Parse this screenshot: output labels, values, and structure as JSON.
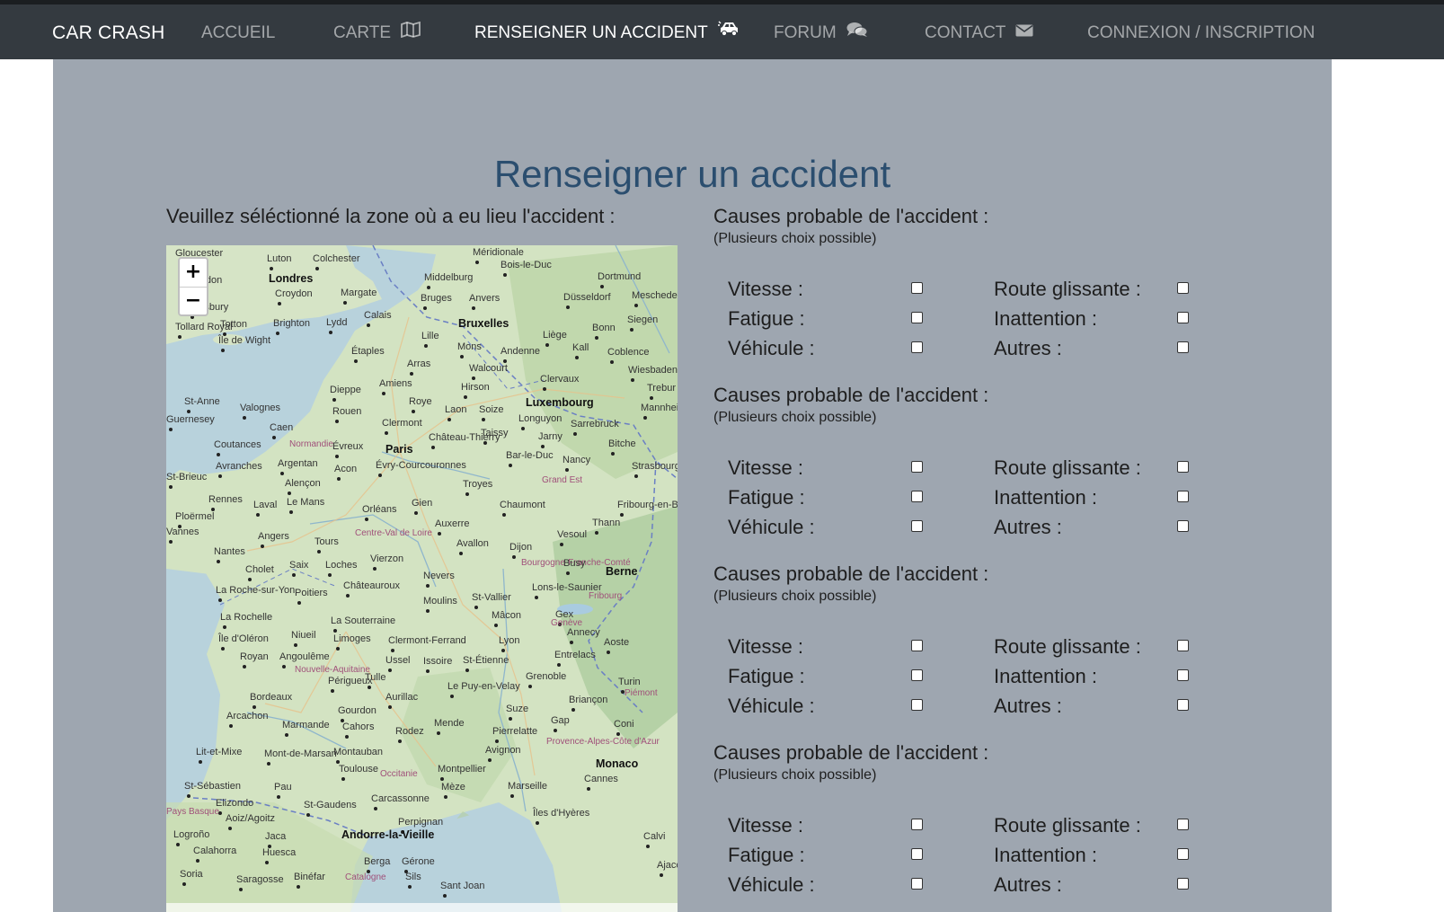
{
  "navbar": {
    "brand": "CAR CRASH",
    "links": [
      "ACCUEIL",
      "CARTE",
      "RENSEIGNER UN ACCIDENT",
      "FORUM",
      "CONTACT",
      "CONNEXION / INSCRIPTION"
    ],
    "active": "RENSEIGNER UN ACCIDENT",
    "icons": [
      "",
      "map-icon",
      "car-crash-icon",
      "comments-icon",
      "envelope-icon",
      ""
    ]
  },
  "page": {
    "title": "Renseigner un accident",
    "map_label": "Veuillez séléctionné la zone où a eu lieu l'accident :"
  },
  "map": {
    "zoom_in": "+",
    "zoom_out": "−",
    "labels": [
      "Gloucester",
      "Luton",
      "Colchester",
      "Méridionale",
      "Bois-le-Duc",
      "Londres",
      "Middelburg",
      "Dortmund",
      "Swindon",
      "Croydon",
      "Margate",
      "Bruges",
      "Anvers",
      "Düsseldorf",
      "Meschede",
      "Salisbury",
      "Calais",
      "Bruxelles",
      "Siegen",
      "Totton",
      "Brighton",
      "Lydd",
      "Lille",
      "Liège",
      "Bonn",
      "Tollard Royal",
      "Île de Wight",
      "Mons",
      "Andenne",
      "Kall",
      "Coblence",
      "Étaples",
      "Arras",
      "Walcourt",
      "Wiesbaden",
      "Dieppe",
      "Amiens",
      "Clervaux",
      "St-Anne",
      "Valognes",
      "Hirson",
      "Luxembourg",
      "Trebur",
      "Guernesey",
      "Rouen",
      "Roye",
      "Laon",
      "Soize",
      "Mannheim",
      "Caen",
      "Clermont",
      "Longuyon",
      "Sarrebruck",
      "Taissy",
      "Coutances",
      "Normandie",
      "Évreux",
      "Paris",
      "Château-Thierry",
      "Jarny",
      "Bitche",
      "Avranches",
      "Argentan",
      "Acon",
      "Évry-Courcouronnes",
      "Bar-le-Duc",
      "Nancy",
      "Strasbourg",
      "St-Brieuc",
      "Alençon",
      "Troyes",
      "Grand Est",
      "Rennes",
      "Laval",
      "Le Mans",
      "Orléans",
      "Chaumont",
      "Fribourg-en-Brisgau",
      "Ploërmel",
      "Gien",
      "Auxerre",
      "Thann",
      "Vannes",
      "Angers",
      "Tours",
      "Centre-Val de Loire",
      "Vesoul",
      "Nantes",
      "Saix",
      "Loches",
      "Vierzon",
      "Avallon",
      "Dijon",
      "Bourgogne-Franche-Comté",
      "Busy",
      "Berne",
      "Cholet",
      "Nevers",
      "Lons-le-Saunier",
      "La Roche-sur-Yon",
      "Poitiers",
      "Châteauroux",
      "Moulins",
      "St-Vallier",
      "Fribourg",
      "La Rochelle",
      "Niueil",
      "La Souterraine",
      "Mâcon",
      "Gex",
      "Genève",
      "Île d'Oléron",
      "Limoges",
      "Clermont-Ferrand",
      "Lyon",
      "Annecy",
      "Royan",
      "Angoulême",
      "Ussel",
      "Issoire",
      "St-Étienne",
      "Entrelacs",
      "Aoste",
      "Nouvelle-Aquitaine",
      "Périgueux",
      "Tulle",
      "Grenoble",
      "Bordeaux",
      "Aurillac",
      "Le Puy-en-Velay",
      "Turin",
      "Piémont",
      "Arcachon",
      "Gourdon",
      "Briançon",
      "Marmande",
      "Cahors",
      "Suze",
      "Rodez",
      "Mende",
      "Gap",
      "Coni",
      "Lit-et-Mixe",
      "Mont-de-Marsan",
      "Montauban",
      "Pierrelatte",
      "Avignon",
      "Provence-Alpes-Côte d'Azur",
      "Toulouse",
      "Occitanie",
      "Montpellier",
      "Monaco",
      "St-Sébastien",
      "Pau",
      "Mèze",
      "Marseille",
      "Cannes",
      "Elizondo",
      "St-Gaudens",
      "Carcassonne",
      "Îles d'Hyères",
      "Pays Basque",
      "Aoiz/Agoitz",
      "Perpignan",
      "Logroño",
      "Jaca",
      "Andorre-la-Vieille",
      "Calahorra",
      "Huesca",
      "Berga",
      "Gérone",
      "Soria",
      "Saragosse",
      "Binéfar",
      "Catalogne",
      "Sils",
      "Sant Joan",
      "Calvi",
      "Ajaccio"
    ]
  },
  "form": {
    "section_title": "Causes probable de l'accident :",
    "section_sub": "(Plusieurs choix possible)",
    "left_options": [
      "Vitesse :",
      "Fatigue :",
      "Véhicule :"
    ],
    "right_options": [
      "Route glissante :",
      "Inattention :",
      "Autres :"
    ],
    "sections": 4
  },
  "colors": {
    "navbar": "#343a40",
    "content_bg": "#9ea6b0",
    "title": "#2b4e6f"
  }
}
